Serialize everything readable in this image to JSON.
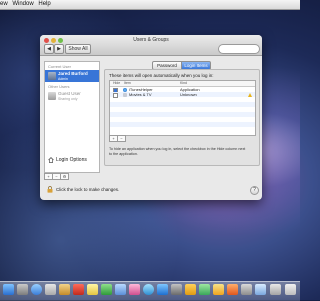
{
  "menubar": {
    "items": [
      "ew",
      "Window",
      "Help"
    ]
  },
  "window": {
    "title": "Users & Groups",
    "show_all_label": "Show All",
    "nav_back": "◀",
    "nav_forward": "▶"
  },
  "sidebar": {
    "current_header": "Current User",
    "current_user": {
      "name": "Jared Burford",
      "role": "Admin"
    },
    "other_header": "Other Users",
    "guest_user": {
      "name": "Guest User",
      "role": "Sharing only"
    },
    "login_options_label": "Login Options",
    "add_label": "+",
    "remove_label": "−",
    "gear_label": "⚙"
  },
  "tabs": {
    "password": "Password",
    "login_items": "Login Items"
  },
  "login_items": {
    "instruction": "These items will open automatically when you log in:",
    "headers": {
      "hide": "Hide",
      "item": "Item",
      "kind": "Kind"
    },
    "rows": [
      {
        "item": "iTunesHelper",
        "kind": "Application",
        "hidden": true
      },
      {
        "item": "Movies & TV",
        "kind": "Unknown",
        "hidden": false
      }
    ],
    "add_label": "+",
    "remove_label": "−",
    "hint": "To hide an application when you log in, select the checkbox in the Hide column next to the application."
  },
  "footer": {
    "lock_text": "Click the lock to make changes.",
    "help_label": "?"
  },
  "colors": {
    "selection": "#3875d7",
    "warning": "#e9b419"
  }
}
